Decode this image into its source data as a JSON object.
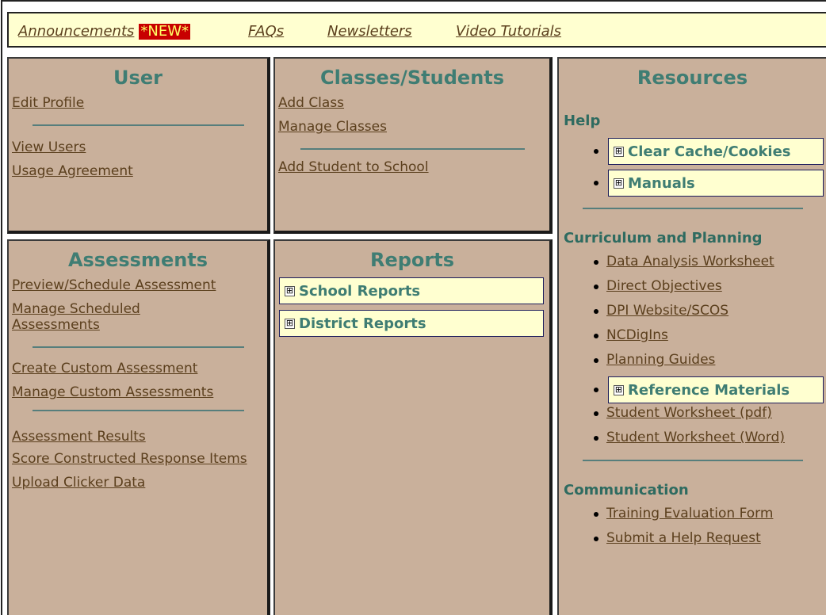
{
  "topnav": {
    "announcements": "Announcements",
    "new_badge": "*NEW*",
    "faqs": "FAQs",
    "newsletters": "Newsletters",
    "video_tutorials": "Video Tutorials"
  },
  "user": {
    "title": "User",
    "edit_profile": "Edit Profile",
    "view_users": "View Users",
    "usage_agreement": "Usage Agreement"
  },
  "classes": {
    "title": "Classes/Students",
    "add_class": "Add Class",
    "manage_classes": "Manage Classes",
    "add_student": "Add Student to School"
  },
  "assessments": {
    "title": "Assessments",
    "preview_schedule": "Preview/Schedule Assessment",
    "manage_scheduled": "Manage Scheduled Assessments",
    "create_custom": "Create Custom Assessment",
    "manage_custom": "Manage Custom Assessments",
    "results": "Assessment Results",
    "score_constructed": "Score Constructed Response Items",
    "upload_clicker": "Upload Clicker Data"
  },
  "reports": {
    "title": "Reports",
    "school_reports": "School Reports",
    "district_reports": "District Reports"
  },
  "resources": {
    "title": "Resources",
    "help_heading": "Help",
    "clear_cache": "Clear Cache/Cookies",
    "manuals": "Manuals",
    "curriculum_heading": "Curriculum and Planning",
    "data_analysis": "Data Analysis Worksheet",
    "direct_objectives": "Direct Objectives",
    "dpi_website": "DPI Website/SCOS",
    "ncdigins": "NCDigIns",
    "planning_guides": "Planning Guides",
    "reference_materials": "Reference Materials",
    "student_worksheet_pdf": "Student Worksheet (pdf)",
    "student_worksheet_word": "Student Worksheet (Word)",
    "communication_heading": "Communication",
    "training_evaluation": "Training Evaluation Form",
    "help_request": "Submit a Help Request"
  },
  "plus_glyph": "⊞"
}
